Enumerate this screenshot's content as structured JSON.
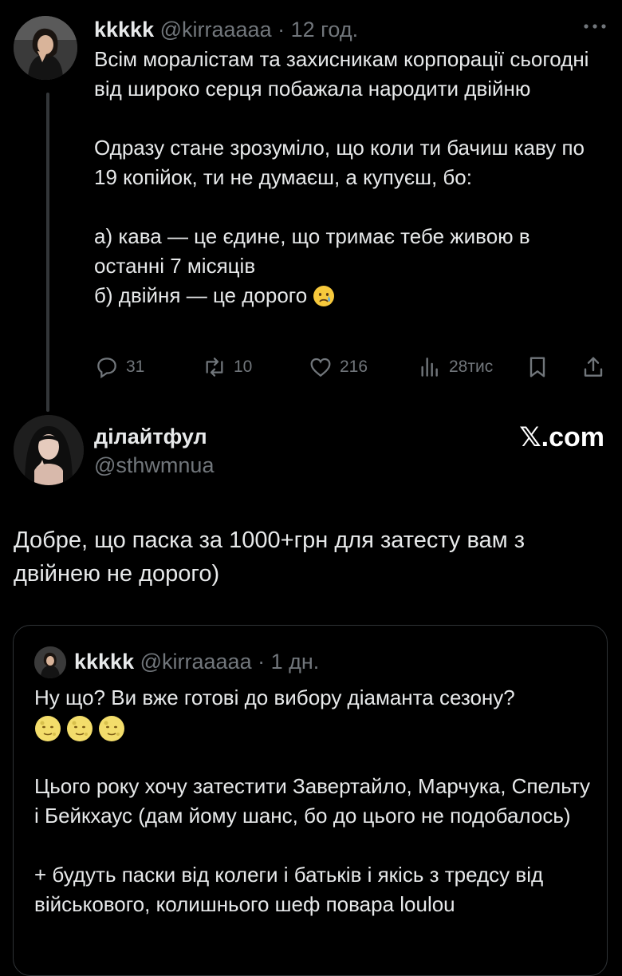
{
  "tweet1": {
    "name": "kkkkk",
    "handle": "@kirraaaaa",
    "separator": "·",
    "time": "12 год.",
    "more_icon": "more-horizontal-icon",
    "text_lines": [
      "Всім моралістам та захисникам корпорації сьогодні від широко серця побажала народити двійню",
      "",
      "Одразу стане зрозуміло, що коли ти бачиш каву по 19 копійок, ти не думаєш, а купуєш, бо:",
      "",
      "а) кава — це єдине, що тримає тебе живою в останні 7 місяців",
      "б) двійня — це дорого"
    ],
    "emoji": "crying-face-emoji",
    "actions": {
      "replies": "31",
      "reposts": "10",
      "likes": "216",
      "views": "28тис"
    },
    "icons": {
      "reply": "reply-icon",
      "repost": "repost-icon",
      "like": "heart-icon",
      "views": "views-icon",
      "bookmark": "bookmark-icon",
      "share": "share-icon"
    }
  },
  "tweet2": {
    "name": "ділайтфул",
    "handle": "@sthwmnua",
    "watermark": "𝕏.com",
    "text": "Добре, що паска за 1000+грн для затесту вам з двійнею не дорого)"
  },
  "quote": {
    "name": "kkkkk",
    "handle": "@kirraaaaa",
    "separator": "·",
    "time": "1 дн.",
    "line1": "Ну що? Ви вже готові до вибору діаманта сезону?",
    "emoji": "full-moon-face-emoji",
    "para2": "Цього року хочу затестити Завертайло, Марчука, Спельту і Бейкхаус (дам йому шанс, бо до цього не подобалось)",
    "para3": "+ будуть паски від колеги і батьків і якісь з тредсу від військового, колишнього шеф повара loulou"
  },
  "colors": {
    "background": "#000000",
    "text": "#e7e9ea",
    "muted": "#71767b",
    "border": "#2f3336"
  }
}
